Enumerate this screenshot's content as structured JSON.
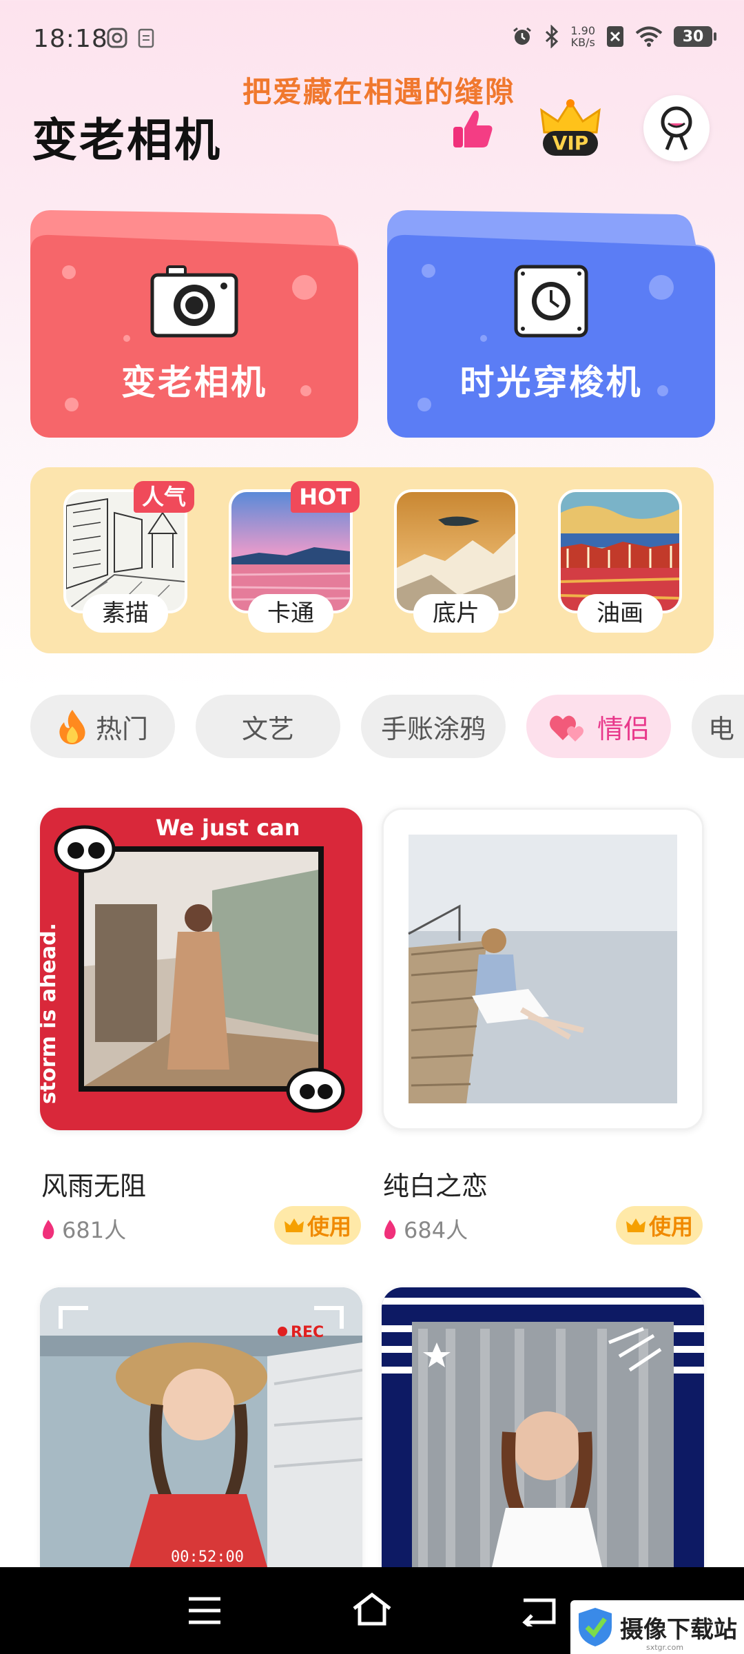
{
  "status_bar": {
    "time": "18:18",
    "net_speed_value": "1.90",
    "net_speed_unit": "KB/s",
    "battery": "30",
    "icons": [
      "screen-record-icon",
      "clipboard-icon",
      "alarm-icon",
      "bluetooth-icon",
      "sim-off-icon",
      "wifi-icon"
    ]
  },
  "header": {
    "banner": "把爱藏在相遇的缝隙",
    "title": "变老相机",
    "vip_label": "VIP"
  },
  "features": [
    {
      "label": "变老相机",
      "color": "#f6666a"
    },
    {
      "label": "时光穿梭机",
      "color": "#5b7df5"
    }
  ],
  "filters": [
    {
      "label": "素描",
      "badge": "人气"
    },
    {
      "label": "卡通",
      "badge": "HOT"
    },
    {
      "label": "底片",
      "badge": ""
    },
    {
      "label": "油画",
      "badge": ""
    }
  ],
  "categories": [
    {
      "label": "热门",
      "active": false
    },
    {
      "label": "文艺",
      "active": false
    },
    {
      "label": "手账涂鸦",
      "active": false
    },
    {
      "label": "情侣",
      "active": true
    },
    {
      "label": "电",
      "active": false
    }
  ],
  "templates": [
    {
      "title": "风雨无阻",
      "count": "681人",
      "use": "使用",
      "frame_text": "We just can't let go when the storm is ahead."
    },
    {
      "title": "纯白之恋",
      "count": "684人",
      "use": "使用"
    },
    {
      "title": "",
      "count": "",
      "use": "",
      "overlay_rec": "REC",
      "overlay_time": "00:52:00"
    },
    {
      "title": "",
      "count": "",
      "use": ""
    }
  ],
  "watermark": {
    "text": "摄像下载站",
    "sub": "sxtgr.com"
  },
  "colors": {
    "accent_pink": "#e8378a",
    "use_orange": "#f08a00",
    "filter_bg": "#fce4ad"
  }
}
